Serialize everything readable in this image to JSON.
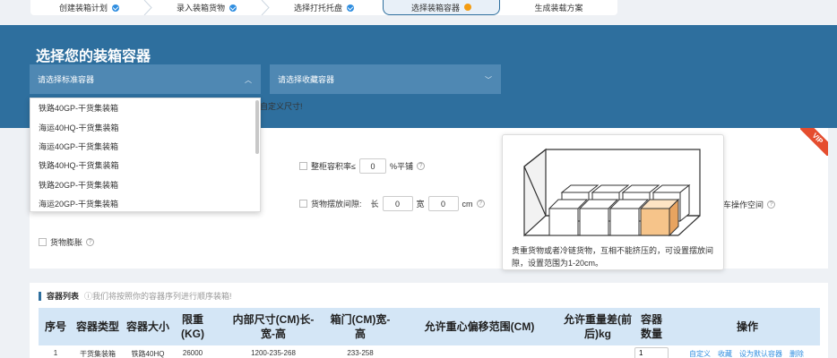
{
  "steps": [
    {
      "label": "创建装箱计划",
      "state": "done"
    },
    {
      "label": "录入装箱货物",
      "state": "done"
    },
    {
      "label": "选择打托托盘",
      "state": "done"
    },
    {
      "label": "选择装箱容器",
      "state": "active"
    },
    {
      "label": "生成装载方案",
      "state": "todo"
    }
  ],
  "header": {
    "title": "选择您的装箱容器",
    "std_select_placeholder": "请选择标准容器",
    "fav_select_placeholder": "请选择收藏容器",
    "custom_hint": "自定义尺寸!"
  },
  "dropdown": {
    "items": [
      "铁路40GP-干货集装箱",
      "海运40HQ-干货集装箱",
      "海运40GP-干货集装箱",
      "铁路40HQ-干货集装箱",
      "铁路20GP-干货集装箱",
      "海运20GP-干货集装箱"
    ]
  },
  "vip": "VIP",
  "options": {
    "full_cabinet_label": "整柜容积率≤",
    "full_cabinet_value": "0",
    "full_cabinet_unit": "%平铺",
    "spacing_label": "货物摆放间隙:",
    "len_label": "长",
    "len_value": "0",
    "wid_label": "宽",
    "wid_value": "0",
    "unit_cm": "cm",
    "forklift_label": "车操作空间",
    "expand_label": "货物膨胀"
  },
  "tooltip": {
    "text": "贵重货物或者冷链货物，互相不能挤压的，可设置摆放间隙，设置范围为1-20cm。"
  },
  "list": {
    "title": "容器列表",
    "subtitle": "ⓘ我们将按照你的容器序列进行顺序装箱!",
    "headers": [
      "序号",
      "容器类型",
      "容器大小",
      "限重(KG)",
      "内部尺寸(CM)长-宽-高",
      "箱门(CM)宽-高",
      "允许重心偏移范围(CM)",
      "允许重量差(前后)kg",
      "容器数量",
      "操作"
    ],
    "row": {
      "index": "1",
      "type": "干货集装箱",
      "size": "铁路40HQ",
      "limit": "26000",
      "inner": "1200-235-268",
      "door": "233-258",
      "qty": "1",
      "actions": [
        "自定义",
        "收藏",
        "设为默认容器",
        "删除"
      ]
    }
  },
  "colors": {
    "primary": "#2e6f9e",
    "accent_blue": "#2f8ee0",
    "step_active_dot": "#f39c12",
    "vip_red": "#e54d2e",
    "box_orange": "#f6c48a"
  }
}
